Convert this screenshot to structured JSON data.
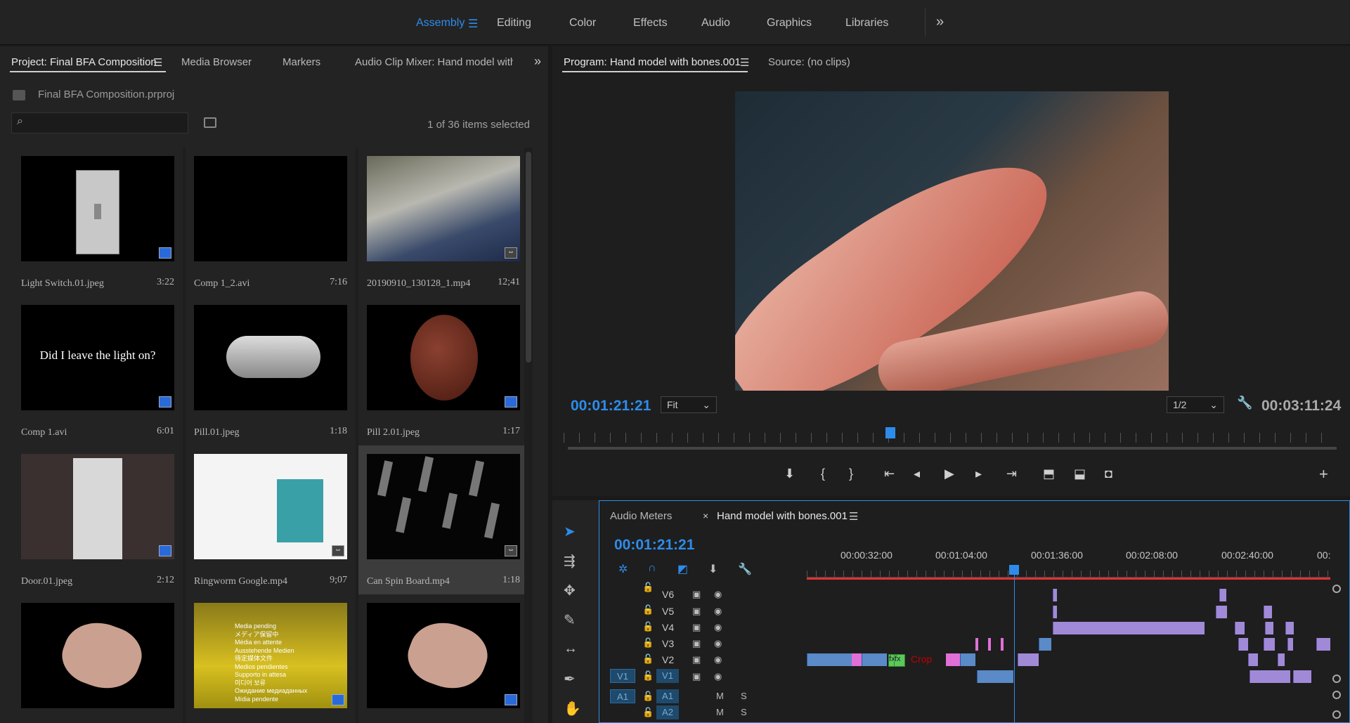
{
  "workspaces": {
    "tabs": [
      "Assembly",
      "Editing",
      "Color",
      "Effects",
      "Audio",
      "Graphics",
      "Libraries"
    ],
    "active": "Assembly"
  },
  "project_panel": {
    "tabs": [
      "Project: Final BFA Composition",
      "Media Browser",
      "Markers",
      "Audio Clip Mixer: Hand model with b"
    ],
    "file": "Final BFA Composition.prproj",
    "search_placeholder": "",
    "selection_status": "1 of 36 items selected",
    "items": [
      {
        "name": "Light Switch.01.jpeg",
        "duration": "3:22"
      },
      {
        "name": "Comp 1_2.avi",
        "duration": "7:16"
      },
      {
        "name": "20190910_130128_1.mp4",
        "duration": "12;41"
      },
      {
        "name": "Comp 1.avi",
        "duration": "6:01",
        "thumb_text": "Did I leave the light on?"
      },
      {
        "name": "Pill.01.jpeg",
        "duration": "1:18"
      },
      {
        "name": "Pill 2.01.jpeg",
        "duration": "1:17"
      },
      {
        "name": "Door.01.jpeg",
        "duration": "2:12"
      },
      {
        "name": "Ringworm Google.mp4",
        "duration": "9;07"
      },
      {
        "name": "Can Spin Board.mp4",
        "duration": "1:18",
        "selected": true
      },
      {
        "name": "",
        "duration": ""
      },
      {
        "name": "",
        "duration": "",
        "thumb_lines": [
          "Media pending",
          "メディア保留中",
          "Média en attente",
          "Ausstehende Medien",
          "待定媒体文件",
          "Medios pendientes",
          "Supporto in attesa",
          "미디어 보류",
          "Ожидание медиаданных",
          "Mídia pendente"
        ]
      },
      {
        "name": "",
        "duration": ""
      }
    ]
  },
  "program_monitor": {
    "tab": "Program: Hand model with bones.001",
    "source_tab": "Source: (no clips)",
    "current_tc": "00:01:21:21",
    "zoom": "Fit",
    "resolution": "1/2",
    "duration_tc": "00:03:11:24",
    "playhead_fraction": 0.42
  },
  "timeline": {
    "tabs": [
      "Audio Meters",
      "Hand model with bones.001"
    ],
    "current_tc": "00:01:21:21",
    "ruler": [
      "00:00:32:00",
      "00:01:04:00",
      "00:01:36:00",
      "00:02:08:00",
      "00:02:40:00",
      "00:"
    ],
    "tracks": [
      {
        "name": "V6"
      },
      {
        "name": "V5"
      },
      {
        "name": "V4"
      },
      {
        "name": "V3"
      },
      {
        "name": "V2"
      },
      {
        "name": "V1",
        "source": "V1"
      },
      {
        "name": "A1",
        "source": "A1",
        "m": "M",
        "s": "S"
      },
      {
        "name": "A2",
        "m": "M",
        "s": "S"
      }
    ],
    "fx_label": "fx",
    "crop_label": "Crop",
    "colors": {
      "video_clip": "#a08ad8",
      "blue_clip": "#5a8ac8",
      "accent": "#2d8ceb"
    }
  }
}
